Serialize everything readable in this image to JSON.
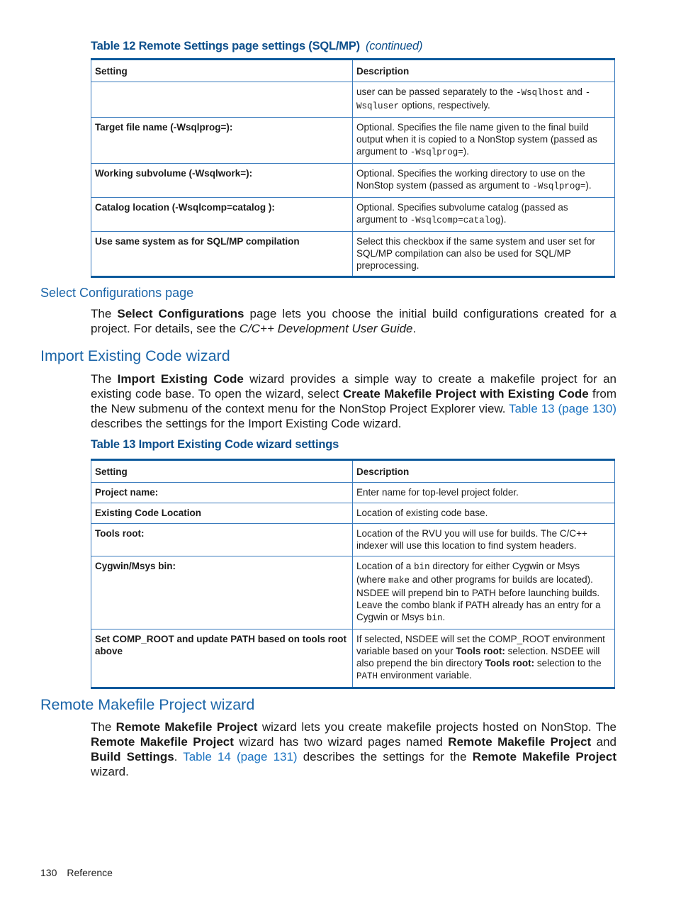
{
  "table12": {
    "caption": "Table 12 Remote Settings page settings (SQL/MP)",
    "continued": "(continued)",
    "headers": [
      "Setting",
      "Description"
    ],
    "rows": [
      {
        "setting": "",
        "desc_parts": [
          "user can be passed separately to the ",
          "-Wsqlhost",
          " and ",
          "-Wsqluser",
          " options, respectively."
        ]
      },
      {
        "setting": "Target file name (-Wsqlprog=):",
        "desc_parts": [
          "Optional. Specifies the file name given to the final build output when it is copied to a NonStop system (passed as argument to ",
          "-Wsqlprog=",
          ")."
        ]
      },
      {
        "setting": "Working subvolume (-Wsqlwork=):",
        "desc_parts": [
          "Optional. Specifies the working directory to use on the NonStop system (passed as argument to ",
          "-Wsqlprog=",
          ")."
        ]
      },
      {
        "setting": "Catalog location (-Wsqlcomp=catalog ):",
        "desc_parts": [
          "Optional. Specifies subvolume catalog (passed as argument to ",
          "-Wsqlcomp=catalog",
          ")."
        ]
      },
      {
        "setting": "Use same system as for SQL/MP compilation",
        "desc_parts": [
          "Select this checkbox if the same system and user set for SQL/MP compilation can also be used for SQL/MP preprocessing."
        ]
      }
    ]
  },
  "select_config": {
    "heading": "Select Configurations page",
    "p1": "The ",
    "b1": "Select Configurations",
    "p2": " page lets you choose the initial build configurations created for a project. For details, see the ",
    "i1": "C/C++ Development User Guide",
    "p3": "."
  },
  "import_code": {
    "heading": "Import Existing Code wizard",
    "p1": "The ",
    "b1": "Import Existing Code",
    "p2": " wizard provides a simple way to create a makefile project for an existing code base. To open the wizard, select ",
    "b2": "Create Makefile Project with Existing Code",
    "p3": " from the New submenu of the context menu for the NonStop Project Explorer view. ",
    "link": "Table 13 (page 130)",
    "p4": " describes the settings for the Import Existing Code wizard."
  },
  "table13": {
    "caption": "Table 13 Import Existing Code wizard settings",
    "headers": [
      "Setting",
      "Description"
    ],
    "rows": [
      {
        "setting": "Project name:",
        "desc": "Enter name for top-level project folder."
      },
      {
        "setting": "Existing Code Location",
        "desc": "Location of existing code base."
      },
      {
        "setting": "Tools root:",
        "desc": "Location of the RVU you will use for builds. The C/C++ indexer will use this location to find system headers."
      },
      {
        "setting": "Cygwin/Msys bin:",
        "desc_parts": [
          "Location of a ",
          "bin",
          " directory for either Cygwin or Msys (where ",
          "make",
          " and other programs for builds are located). NSDEE will prepend bin to PATH before launching builds. Leave the combo blank if PATH already has an entry for a Cygwin or Msys ",
          "bin",
          "."
        ]
      },
      {
        "setting": "Set COMP_ROOT and update PATH based on tools root above",
        "desc_parts": [
          "If selected, NSDEE will set the COMP_ROOT environment variable based on your ",
          "Tools root:",
          " selection. NSDEE will also prepend the bin directory ",
          "Tools root:",
          " selection to the ",
          "PATH",
          " environment variable."
        ]
      }
    ]
  },
  "remote_makefile": {
    "heading": "Remote Makefile Project wizard",
    "p1": "The ",
    "b1": "Remote Makefile Project",
    "p2": " wizard lets you create makefile projects hosted on NonStop. The ",
    "b2": "Remote Makefile Project",
    "p3": " wizard has two wizard pages named ",
    "b3": "Remote Makefile Project",
    "p4": " and ",
    "b4": "Build Settings",
    "p5": ". ",
    "link": "Table 14 (page 131)",
    "p6": " describes the settings for the ",
    "b5": "Remote Makefile Project",
    "p7": " wizard."
  },
  "footer": {
    "page_number": "130",
    "section": "Reference"
  }
}
